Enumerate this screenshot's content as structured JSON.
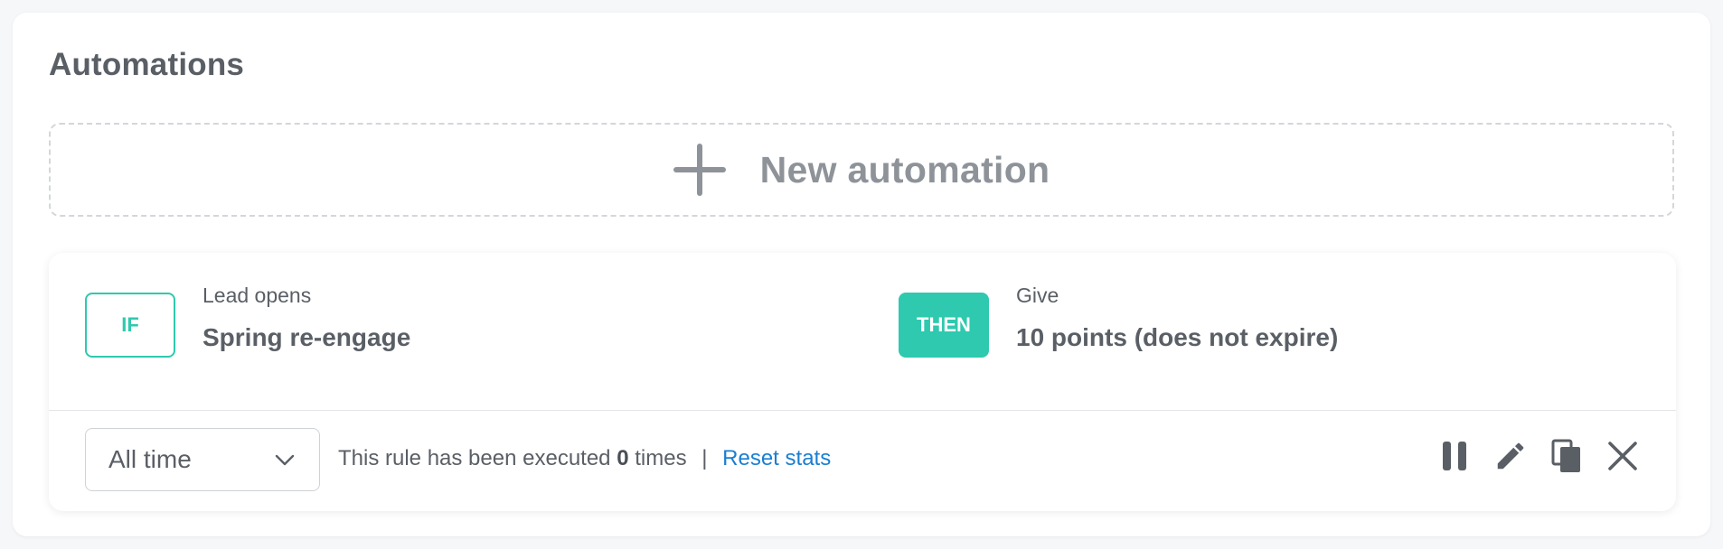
{
  "panel": {
    "title": "Automations",
    "new_automation_label": "New automation"
  },
  "rule": {
    "if_badge": "IF",
    "trigger_label": "Lead opens",
    "trigger_value": "Spring re-engage",
    "then_badge": "THEN",
    "action_label": "Give",
    "action_value": "10 points (does not expire)"
  },
  "footer": {
    "period_selected": "All time",
    "stats_prefix": "This rule has been executed",
    "stats_count": "0",
    "stats_suffix": "times",
    "separator": "|",
    "reset_label": "Reset stats"
  },
  "icons": {
    "add": "plus-icon",
    "dropdown": "chevron-down-icon",
    "pause": "pause-icon",
    "edit": "pencil-icon",
    "duplicate": "copy-icon",
    "delete": "close-icon"
  },
  "colors": {
    "accent": "#2ec9ae",
    "link": "#1a7fd1",
    "text": "#5a5f66",
    "muted": "#8e9399"
  }
}
